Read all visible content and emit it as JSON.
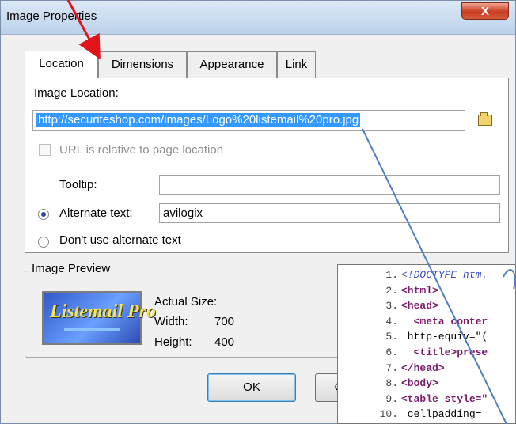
{
  "window": {
    "title": "Image Properties",
    "close_label": "X"
  },
  "tabs": [
    {
      "label": "Location",
      "active": true
    },
    {
      "label": "Dimensions",
      "active": false
    },
    {
      "label": "Appearance",
      "active": false
    },
    {
      "label": "Link",
      "active": false
    }
  ],
  "location": {
    "image_location_label": "Image Location:",
    "url": "http://securiteshop.com/images/Logo%20listemail%20pro.jpg",
    "relative_checkbox_label": "URL is relative to page location",
    "tooltip_label": "Tooltip:",
    "tooltip_value": "",
    "alternate_text_label": "Alternate text:",
    "alternate_text_value": "avilogix",
    "no_alternate_label": "Don't use alternate text"
  },
  "preview": {
    "legend": "Image Preview",
    "actual_size_label": "Actual Size:",
    "width_label": "Width:",
    "width_value": "700",
    "height_label": "Height:",
    "height_value": "400",
    "logo_text": "Listemail Pro"
  },
  "buttons": {
    "ok": "OK",
    "cancel_partial": "C"
  },
  "code_snippet": [
    {
      "num": "1.",
      "text": "<!DOCTYPE htm."
    },
    {
      "num": "2.",
      "text": "<html>"
    },
    {
      "num": "3.",
      "text": "<head>"
    },
    {
      "num": "4.",
      "text": "  <meta conter"
    },
    {
      "num": "5.",
      "text": " http-equiv=\"("
    },
    {
      "num": "6.",
      "text": "  <title>prese"
    },
    {
      "num": "7.",
      "text": "</head>"
    },
    {
      "num": "8.",
      "text": "<body>"
    },
    {
      "num": "9.",
      "text": "<table style=\""
    },
    {
      "num": "10.",
      "text": " cellpadding="
    }
  ],
  "colors": {
    "arrow_red": "#e0141b",
    "connector_blue": "#4f7fbf",
    "selection": "#3399ff"
  }
}
